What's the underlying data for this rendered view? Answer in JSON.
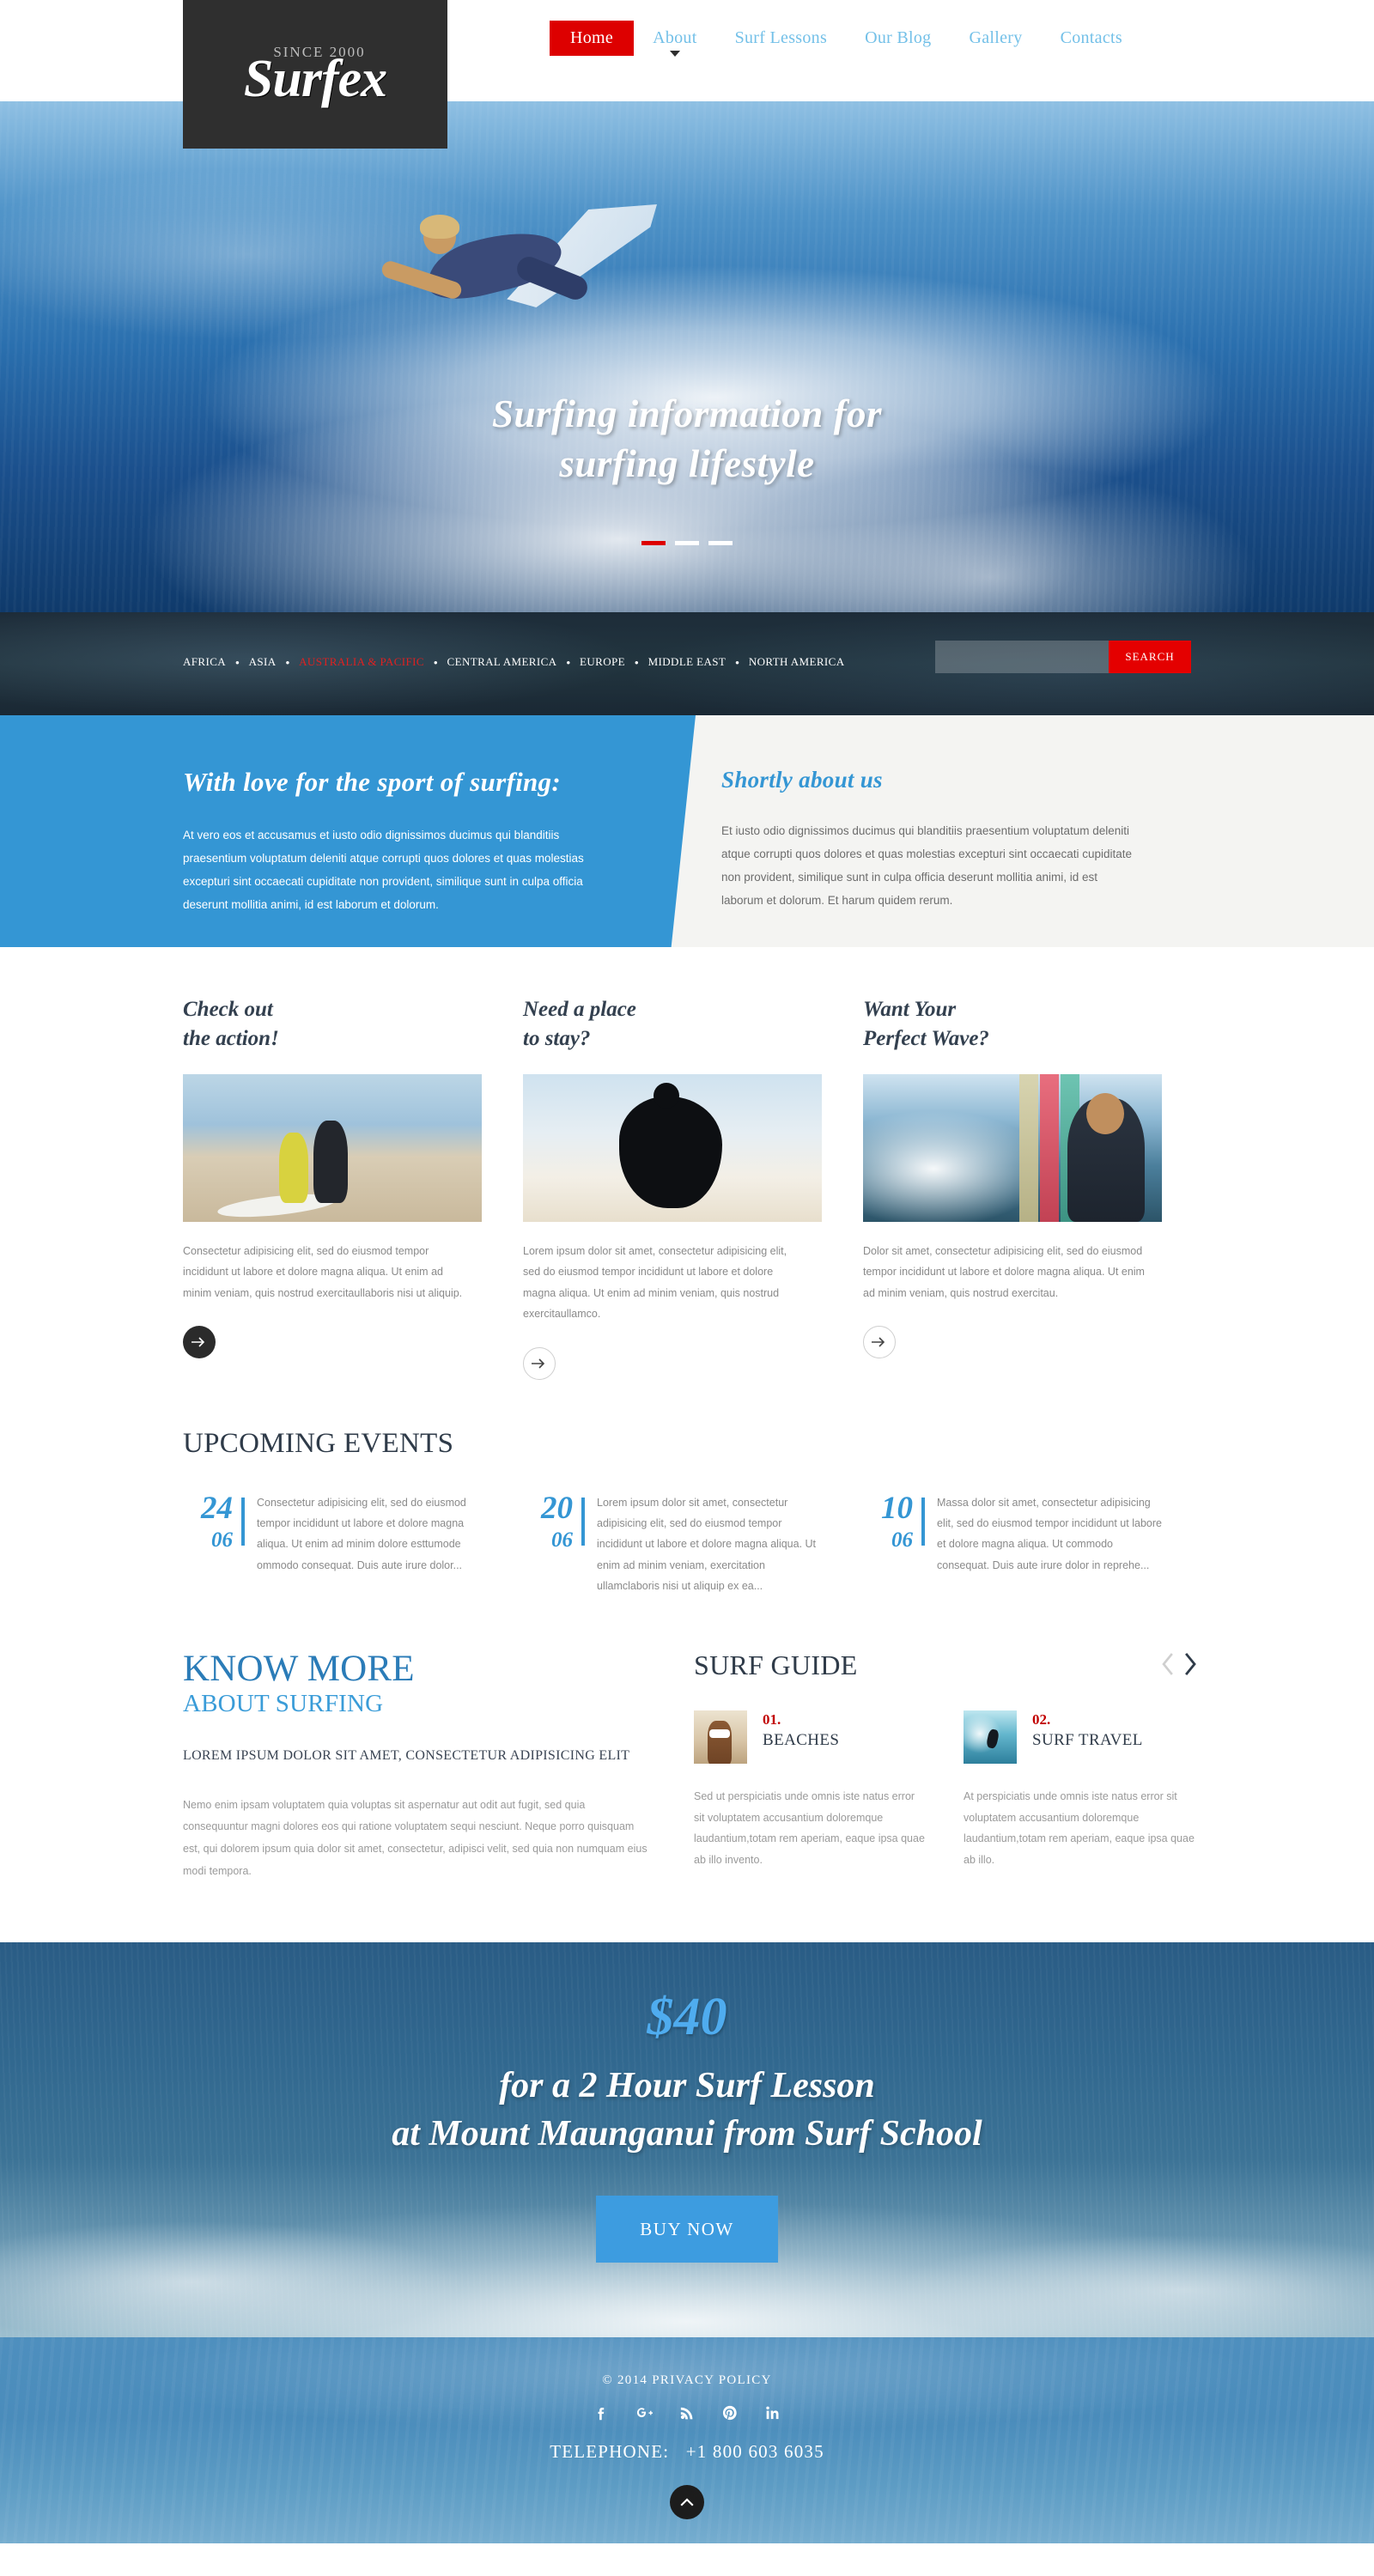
{
  "brand": {
    "since": "SINCE 2000",
    "name": "Surfex"
  },
  "nav": {
    "items": [
      {
        "label": "Home",
        "active": true
      },
      {
        "label": "About",
        "active": false,
        "caret": true
      },
      {
        "label": "Surf Lessons",
        "active": false
      },
      {
        "label": "Our Blog",
        "active": false
      },
      {
        "label": "Gallery",
        "active": false
      },
      {
        "label": "Contacts",
        "active": false
      }
    ]
  },
  "hero": {
    "title_line1": "Surfing information for",
    "title_line2": "surfing lifestyle",
    "slides": 3,
    "active_slide": 1,
    "accent": "#dd0000"
  },
  "regions": {
    "items": [
      {
        "label": "AFRICA",
        "active": false
      },
      {
        "label": "ASIA",
        "active": false
      },
      {
        "label": "AUSTRALIA & PACIFIC",
        "active": true
      },
      {
        "label": "CENTRAL AMERICA",
        "active": false
      },
      {
        "label": "EUROPE",
        "active": false
      },
      {
        "label": "MIDDLE EAST",
        "active": false
      },
      {
        "label": "NORTH AMERICA",
        "active": false
      }
    ],
    "separator": "•"
  },
  "search": {
    "value": "",
    "placeholder": "",
    "button_label": "SEARCH"
  },
  "intro": {
    "left_heading": "With love for the sport of surfing:",
    "left_text": "At vero eos et accusamus et iusto odio dignissimos ducimus qui blanditiis praesentium voluptatum deleniti atque corrupti quos dolores et quas molestias excepturi sint occaecati cupiditate non provident, similique sunt in culpa officia deserunt mollitia animi, id est laborum et dolorum.",
    "right_heading": "Shortly about us",
    "right_text": "Et iusto odio dignissimos ducimus qui blanditiis praesentium voluptatum deleniti atque corrupti quos dolores et quas molestias excepturi sint occaecati cupiditate non provident, similique sunt in culpa officia deserunt mollitia animi, id est laborum et dolorum. Et harum quidem rerum."
  },
  "features": [
    {
      "heading_line1": "Check out",
      "heading_line2": "the action!",
      "text": "Consectetur adipisicing elit, sed do eiusmod tempor incididunt ut labore et dolore magna aliqua. Ut enim ad minim veniam, quis nostrud exercitaullaboris nisi ut aliquip.",
      "image_alt": "surfers-running-on-beach",
      "arrow_style": "dark"
    },
    {
      "heading_line1": "Need a place",
      "heading_line2": "to stay?",
      "text": "Lorem ipsum dolor sit amet, consectetur adipisicing elit, sed do eiusmod tempor incididunt ut labore et dolore magna aliqua. Ut enim ad minim veniam, quis nostrud exercitaullamco.",
      "image_alt": "surfer-silhouette-carrying-board",
      "arrow_style": "light"
    },
    {
      "heading_line1": "Want Your",
      "heading_line2": "Perfect Wave?",
      "text": "Dolor sit amet, consectetur adipisicing elit, sed do eiusmod tempor incididunt ut labore et dolore magna aliqua. Ut enim ad minim veniam, quis nostrud exercitau.",
      "image_alt": "surfer-with-boards",
      "arrow_style": "light"
    }
  ],
  "events": {
    "heading": "UPCOMING EVENTS",
    "items": [
      {
        "day": "24",
        "month": "06",
        "text": "Consectetur adipisicing elit, sed do eiusmod tempor incididunt ut labore et dolore magna aliqua. Ut enim ad minim dolore esttumode ommodo consequat. Duis aute irure dolor..."
      },
      {
        "day": "20",
        "month": "06",
        "text": "Lorem ipsum dolor sit amet, consectetur adipisicing elit, sed do eiusmod tempor incididunt ut labore et dolore magna aliqua. Ut enim ad minim veniam, exercitation ullamclaboris nisi ut aliquip ex ea..."
      },
      {
        "day": "10",
        "month": "06",
        "text": "Massa dolor sit amet, consectetur adipisicing elit, sed do eiusmod tempor incididunt ut labore et dolore magna aliqua. Ut commodo consequat. Duis aute irure dolor in reprehe..."
      }
    ]
  },
  "know_more": {
    "heading_line1": "KNOW MORE",
    "heading_line2": "ABOUT SURFING",
    "subheading": "LOREM IPSUM DOLOR SIT AMET, CONSECTETUR ADIPISICING ELIT",
    "text": "Nemo enim ipsam voluptatem quia voluptas sit aspernatur aut odit aut fugit, sed quia consequuntur magni dolores eos qui ratione voluptatem sequi nesciunt. Neque porro quisquam est, qui dolorem ipsum quia dolor sit amet, consectetur, adipisci velit, sed quia non numquam eius modi tempora."
  },
  "surf_guide": {
    "heading": "SURF GUIDE",
    "items": [
      {
        "num": "01.",
        "title": "BEACHES",
        "text": "Sed ut perspiciatis unde omnis iste natus error sit voluptatem accusantium doloremque laudantium,totam rem aperiam, eaque ipsa quae ab illo invento.",
        "image_alt": "woman-with-surfboard"
      },
      {
        "num": "02.",
        "title": "SURF TRAVEL",
        "text": "At perspiciatis unde omnis iste natus error sit voluptatem accusantium doloremque laudantium,totam rem aperiam, eaque ipsa quae ab illo.",
        "image_alt": "surfer-riding-barrel-wave"
      }
    ]
  },
  "promo": {
    "price": "$40",
    "line1": "for a 2 Hour Surf Lesson",
    "line2": "at Mount Maunganui from Surf School",
    "button_label": "BUY NOW",
    "button_color": "#3d9ce0"
  },
  "footer": {
    "copyright": "© 2014 PRIVACY POLICY",
    "socials": [
      {
        "name": "facebook",
        "glyph": "f"
      },
      {
        "name": "google-plus",
        "glyph": "g+"
      },
      {
        "name": "rss",
        "glyph": "rss"
      },
      {
        "name": "pinterest",
        "glyph": "p"
      },
      {
        "name": "linkedin",
        "glyph": "in"
      }
    ],
    "telephone_label": "TELEPHONE:",
    "telephone_number": "+1 800 603 6035"
  }
}
